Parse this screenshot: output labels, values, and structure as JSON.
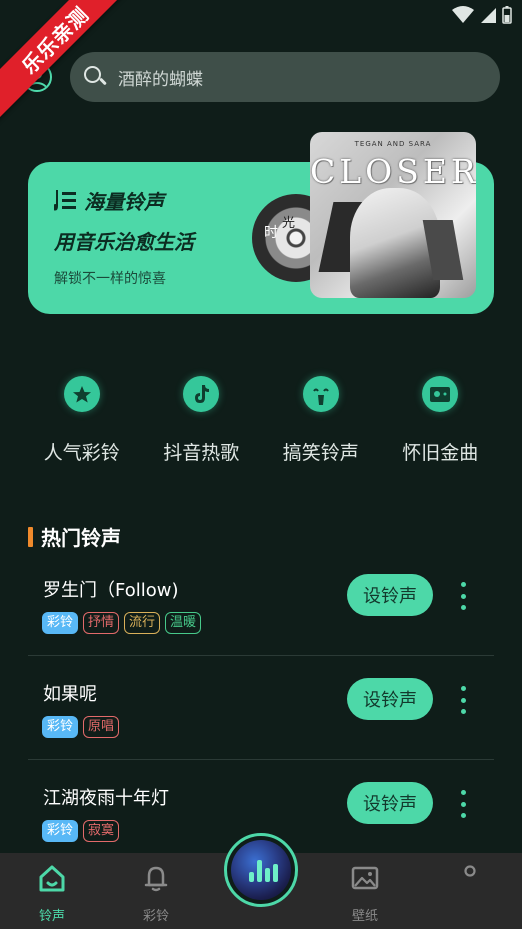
{
  "ribbon": {
    "text": "乐乐亲测"
  },
  "search": {
    "placeholder": "酒醉的蝴蝶"
  },
  "banner": {
    "title1": "海量铃声",
    "title2": "用音乐治愈生活",
    "subtitle": "解锁不一样的惊喜",
    "disc_text1": "时",
    "disc_text2": "光",
    "cover_top": "TEGAN AND SARA",
    "cover_title": "CLOSER"
  },
  "categories": [
    {
      "label": "人气彩铃",
      "icon": "star-medal-icon"
    },
    {
      "label": "抖音热歌",
      "icon": "tiktok-icon"
    },
    {
      "label": "搞笑铃声",
      "icon": "funny-face-icon"
    },
    {
      "label": "怀旧金曲",
      "icon": "cassette-icon"
    }
  ],
  "section": {
    "title": "热门铃声"
  },
  "songs": [
    {
      "title": "罗生门（Follow)",
      "tags": [
        "彩铃",
        "抒情",
        "流行",
        "温暖"
      ],
      "button": "设铃声"
    },
    {
      "title": "如果呢",
      "tags": [
        "彩铃",
        "原唱"
      ],
      "button": "设铃声"
    },
    {
      "title": "江湖夜雨十年灯",
      "tags": [
        "彩铃",
        "寂寞"
      ],
      "button": "设铃声"
    }
  ],
  "tag_colors": {
    "彩铃": "#58b8f6",
    "抒情": "#e26a6a",
    "流行": "#d9b05a",
    "温暖": "#47c98a",
    "原唱": "#e26a6a",
    "寂寞": "#e26a6a"
  },
  "nav": {
    "items": [
      {
        "label": "铃声",
        "icon": "home-icon",
        "active": true
      },
      {
        "label": "彩铃",
        "icon": "bell-icon",
        "active": false
      },
      {
        "label": "",
        "icon": "music-disc-icon",
        "active": false
      },
      {
        "label": "壁纸",
        "icon": "image-icon",
        "active": false
      },
      {
        "label": "",
        "icon": "profile-icon",
        "active": false
      }
    ]
  },
  "colors": {
    "accent": "#4dd8a8",
    "background": "#0f1d19",
    "nav_bg": "#2a2a2a",
    "section_bar": "#f08a2c"
  }
}
